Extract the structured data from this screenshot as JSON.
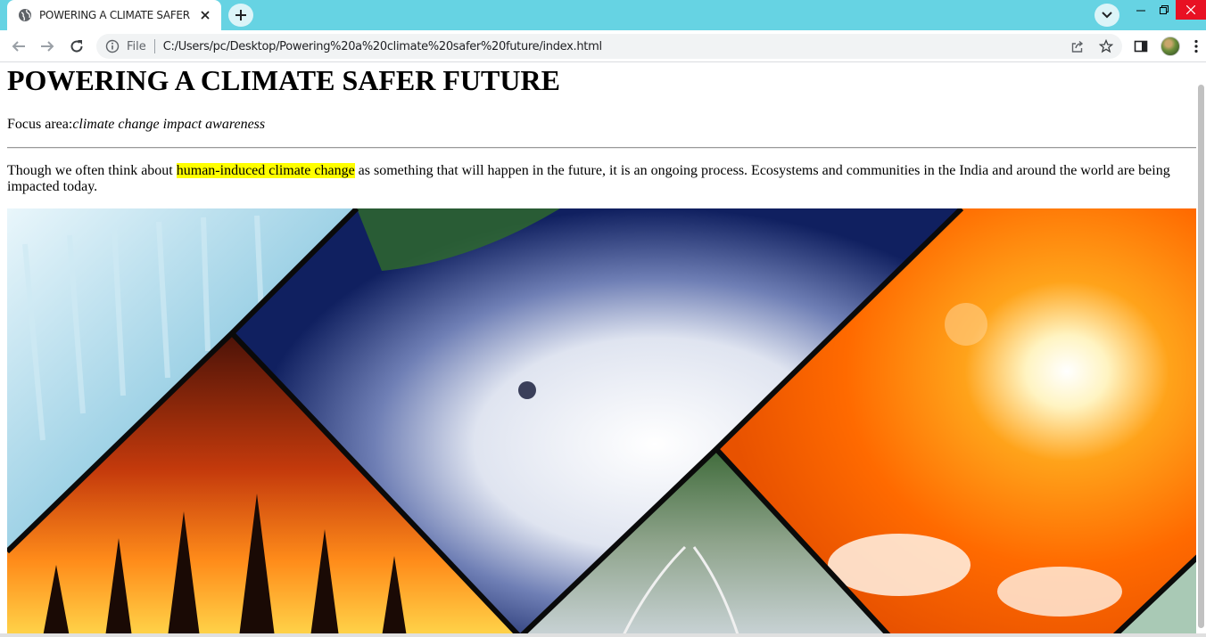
{
  "browser": {
    "tab_title": "POWERING A CLIMATE SAFER FU",
    "file_label": "File",
    "url": "C:/Users/pc/Desktop/Powering%20a%20climate%20safer%20future/index.html",
    "accent_color": "#66d3e3"
  },
  "page": {
    "heading": "POWERING A CLIMATE SAFER FUTURE",
    "focus_label": "Focus area:",
    "focus_value": "climate change impact awareness",
    "para_before": "Though we often think about ",
    "para_highlight": "human-induced climate change",
    "para_after": " as something that will happen in the future, it is an ongoing process. Ecosystems and communities in the India and around the world are being impacted today.",
    "highlight_color": "#ffff00"
  },
  "collage": {
    "panels": [
      "glacier",
      "wildfire",
      "hurricane",
      "flooded-road",
      "sun"
    ]
  }
}
